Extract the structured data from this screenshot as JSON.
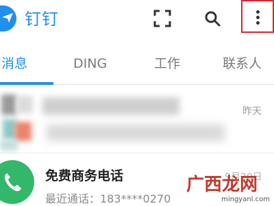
{
  "header": {
    "app_title": "钉钉",
    "icons": [
      "dingtalk-logo-icon",
      "scan-icon",
      "search-icon",
      "more-vertical-icon"
    ],
    "highlight_color": "#d8242a",
    "brand_color": "#1f8ff0"
  },
  "tabs": [
    {
      "label": "消息",
      "active": true
    },
    {
      "label": "DING",
      "active": false
    },
    {
      "label": "工作",
      "active": false
    },
    {
      "label": "联系人",
      "active": false
    }
  ],
  "conversations": [
    {
      "time": "昨天"
    },
    {
      "title": "免费商务电话",
      "date": "9月20日",
      "preview": "最近通话：183****0270",
      "icon": "phone-icon",
      "avatar_color": "#33b86b"
    }
  ],
  "watermark": {
    "brand": "广西龙网",
    "url": "mingyanl.com"
  }
}
